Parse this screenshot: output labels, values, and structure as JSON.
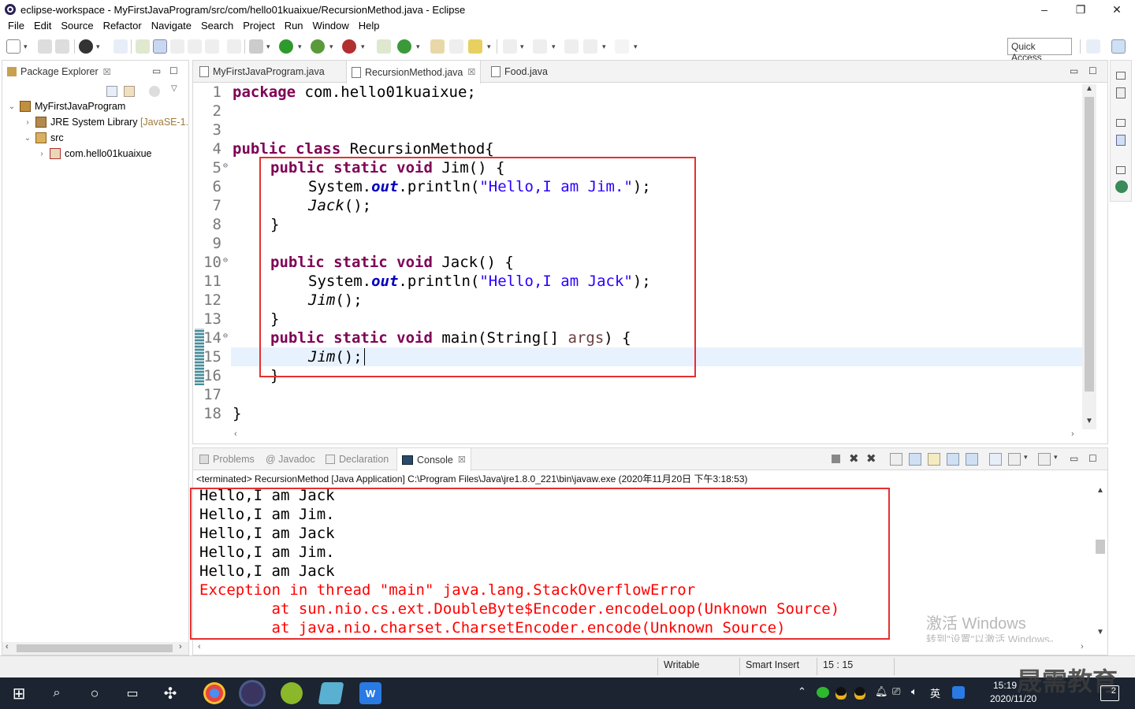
{
  "window": {
    "title": "eclipse-workspace - MyFirstJavaProgram/src/com/hello01kuaixue/RecursionMethod.java - Eclipse",
    "controls": [
      "–",
      "❐",
      "✕"
    ]
  },
  "menubar": [
    "File",
    "Edit",
    "Source",
    "Refactor",
    "Navigate",
    "Search",
    "Project",
    "Run",
    "Window",
    "Help"
  ],
  "toolbar": {
    "quick_access": "Quick Access"
  },
  "package_explorer": {
    "title": "Package Explorer",
    "close": "☒",
    "tree": [
      {
        "label": "MyFirstJavaProgram",
        "expanded": "⌄",
        "icon": "java-project-icon"
      },
      {
        "label": "JRE System Library",
        "suffix": "[JavaSE-1.",
        "expanded": "›",
        "icon": "library-icon"
      },
      {
        "label": "src",
        "expanded": "⌄",
        "icon": "source-folder-icon"
      },
      {
        "label": "com.hello01kuaixue",
        "expanded": "›",
        "icon": "package-icon"
      }
    ]
  },
  "editor": {
    "tabs": [
      {
        "label": "MyFirstJavaProgram.java",
        "active": false
      },
      {
        "label": "RecursionMethod.java",
        "active": true,
        "close": "☒"
      },
      {
        "label": "Food.java",
        "active": false
      }
    ],
    "line_numbers": [
      "1",
      "2",
      "3",
      "4",
      "5",
      "6",
      "7",
      "8",
      "9",
      "10",
      "11",
      "12",
      "13",
      "14",
      "15",
      "16",
      "17",
      "18"
    ],
    "code": {
      "l1": {
        "kw": "package",
        "rest": " com.hello01kuaixue;"
      },
      "l4": {
        "kw": "public class",
        "rest": " RecursionMethod{"
      },
      "l5": {
        "kw": "public static void",
        "rest": " Jim() {"
      },
      "l6": {
        "a": "System.",
        "fld": "out",
        "b": ".println(",
        "str": "\"Hello,I am Jim.\"",
        "c": ");"
      },
      "l7": {
        "ital": "Jack",
        "rest": "();"
      },
      "l8": "}",
      "l10": {
        "kw": "public static void",
        "rest": " Jack() {"
      },
      "l11": {
        "a": "System.",
        "fld": "out",
        "b": ".println(",
        "str": "\"Hello,I am Jack\"",
        "c": ");"
      },
      "l12": {
        "ital": "Jim",
        "rest": "();"
      },
      "l13": "}",
      "l14": {
        "kw": "public static void",
        "a": " main(String[] ",
        "param": "args",
        "b": ") {"
      },
      "l15": {
        "ital": "Jim",
        "rest": "();"
      },
      "l16": "}",
      "l18": "}"
    }
  },
  "console_panel": {
    "tabs": [
      {
        "label": "Problems"
      },
      {
        "label": "@ Javadoc"
      },
      {
        "label": "Declaration"
      },
      {
        "label": "Console",
        "active": true,
        "close": "☒"
      }
    ],
    "header": "<terminated> RecursionMethod [Java Application] C:\\Program Files\\Java\\jre1.8.0_221\\bin\\javaw.exe (2020年11月20日 下午3:18:53)",
    "output": [
      {
        "text": "Hello,I am Jack",
        "error": false
      },
      {
        "text": "Hello,I am Jim.",
        "error": false
      },
      {
        "text": "Hello,I am Jack",
        "error": false
      },
      {
        "text": "Hello,I am Jim.",
        "error": false
      },
      {
        "text": "Hello,I am Jack",
        "error": false
      },
      {
        "text": "Exception in thread \"main\" java.lang.StackOverflowError",
        "error": true
      },
      {
        "text": "\tat sun.nio.cs.ext.DoubleByte$Encoder.encodeLoop(Unknown Source)",
        "error": true
      },
      {
        "text": "\tat java.nio.charset.CharsetEncoder.encode(Unknown Source)",
        "error": true
      }
    ]
  },
  "watermark": {
    "line1": "激活 Windows",
    "line2": "转到\"设置\"以激活 Windows。"
  },
  "statusbar": {
    "mode": "Writable",
    "insert": "Smart Insert",
    "position": "15 : 15"
  },
  "taskbar": {
    "time": "15:19",
    "date": "2020/11/20",
    "ime": "英",
    "brand": "晟需教育",
    "notif": "2"
  }
}
